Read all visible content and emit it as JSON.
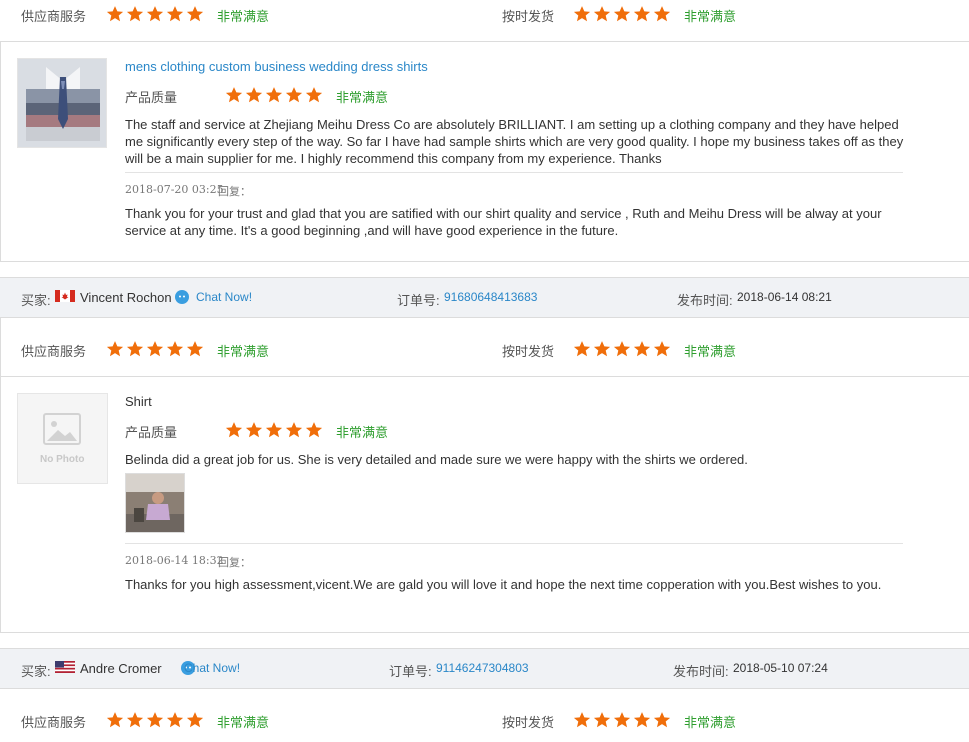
{
  "labels": {
    "supplier_service": "供应商服务",
    "on_time_delivery": "按时发货",
    "product_quality": "产品质量",
    "very_satisfied": "非常满意",
    "reply": "回复：",
    "buyer": "买家:",
    "order_no": "订单号:",
    "published": "发布时间:",
    "chat_now": "Chat Now!",
    "no_photo": "No Photo"
  },
  "review1": {
    "product": "mens clothing custom business wedding dress shirts",
    "text": "The staff and service at Zhejiang Meihu Dress Co are absolutely BRILLIANT. I am setting up a clothing company and they have helped me significantly every step of the way. So far I have had sample shirts which are very good quality. I hope my business takes off as they will be a main supplier for me. I highly recommend this company from my experience. Thanks",
    "reply_time": "2018-07-20 03:25",
    "reply_text": "Thank you for your trust and glad that you are satified with our shirt quality and service , Ruth and Meihu Dress will be alway at your service at any time. It's a good beginning ,and will have good experience in the future."
  },
  "review2": {
    "buyer_name": "Vincent Rochon",
    "order_no": "91680648413683",
    "published": "2018-06-14 08:21",
    "product": "Shirt",
    "text": "Belinda did a great job for us. She is very detailed and made sure we were happy with the shirts we ordered.",
    "reply_time": "2018-06-14 18:32",
    "reply_text": "Thanks for you high assessment,vicent.We are gald you will love it and hope the next time copperation with you.Best wishes to you."
  },
  "review3": {
    "buyer_name": "Andre Cromer",
    "order_no": "91146247304803",
    "published": "2018-05-10 07:24"
  },
  "ratings": {
    "stars": 5,
    "star_color": "#f06e0a",
    "satisfied_color": "#2e9e2e",
    "link_color": "#2a87c8"
  },
  "icons": {
    "flag_ca": "canada-flag-icon",
    "flag_us": "usa-flag-icon",
    "chat": "chat-bubble-icon",
    "image_placeholder": "image-placeholder-icon"
  }
}
